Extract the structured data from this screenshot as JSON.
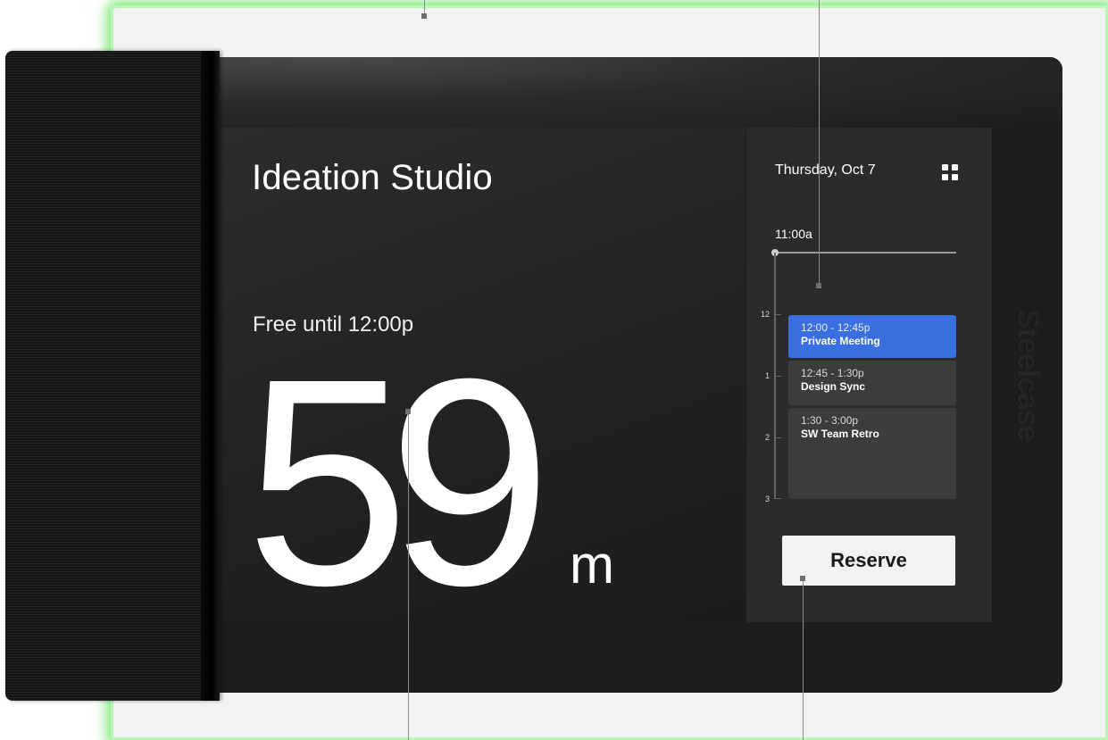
{
  "room": {
    "name": "Ideation Studio",
    "status": "Free until 12:00p",
    "countdown_value": "59",
    "countdown_unit": "m"
  },
  "schedule": {
    "date": "Thursday, Oct 7",
    "current_time": "11:00a",
    "menu_icon": "grid-icon",
    "hour_labels": [
      "12",
      "1",
      "2",
      "3"
    ],
    "events": [
      {
        "time": "12:00 - 12:45p",
        "title": "Private Meeting",
        "color": "#3a6fe0"
      },
      {
        "time": "12:45 - 1:30p",
        "title": "Design Sync",
        "color": "#3c3c3c"
      },
      {
        "time": "1:30 - 3:00p",
        "title": "SW Team Retro",
        "color": "#3c3c3c"
      }
    ],
    "reserve_label": "Reserve"
  },
  "device": {
    "brand": "Steelcase",
    "status_light_color": "#7de87a"
  }
}
